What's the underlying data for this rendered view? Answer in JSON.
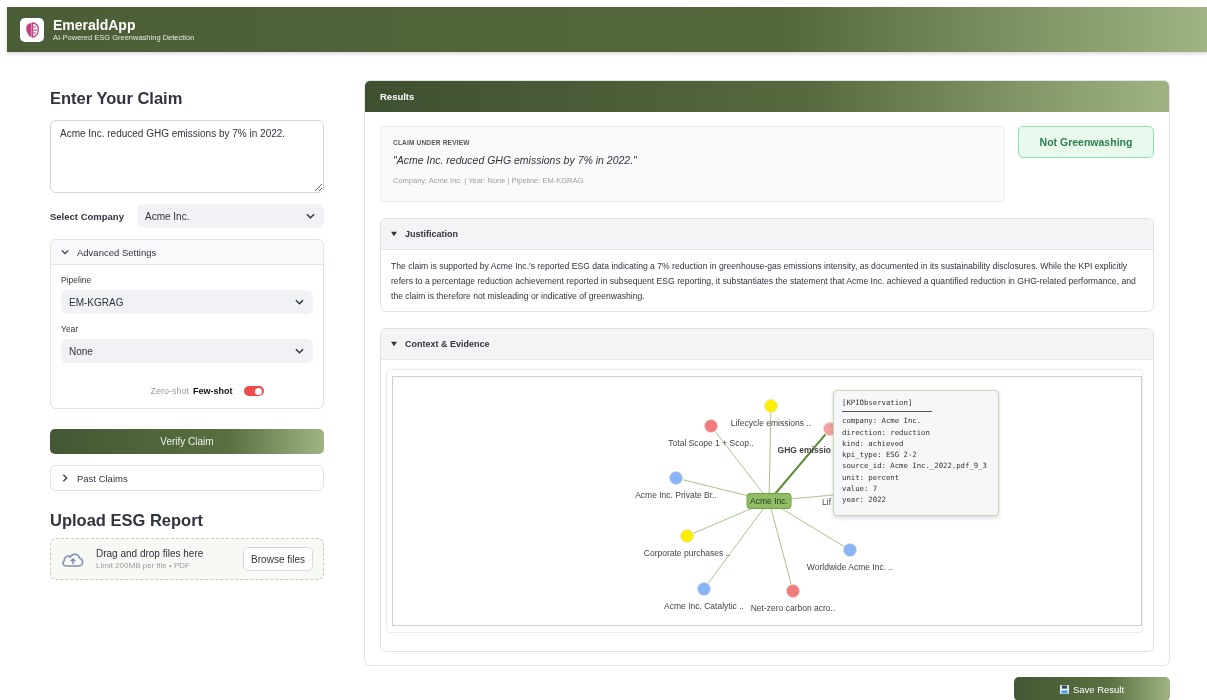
{
  "header": {
    "title": "EmeraldApp",
    "subtitle": "AI-Powered ESG Greenwashing Detection"
  },
  "claim_form": {
    "heading": "Enter Your Claim",
    "claim_value": "Acme Inc. reduced GHG emissions by 7% in 2022.",
    "company": {
      "label": "Select Company",
      "value": "Acme Inc."
    },
    "advanced_settings": {
      "title": "Advanced Settings",
      "expanded": true,
      "pipeline": {
        "label": "Pipeline",
        "value": "EM-KGRAG"
      },
      "year": {
        "label": "Year",
        "value": "None"
      },
      "mode_toggle": {
        "off_label": "Zero-shot",
        "on_label": "Few-shot",
        "on": true
      }
    },
    "verify_button": "Verify Claim",
    "past_claims": {
      "title": "Past Claims",
      "expanded": false
    }
  },
  "upload": {
    "heading": "Upload ESG Report",
    "drop_text": "Drag and drop files here",
    "limit_text": "Limit 200MB per file • PDF",
    "browse_button": "Browse files"
  },
  "results": {
    "title": "Results",
    "claim_label": "CLAIM UNDER REVIEW",
    "claim_quote": "\"Acme Inc. reduced GHG emissions by 7% in 2022.\"",
    "meta": "Company: Acme Inc. | Year: None | Pipeline: EM-KGRAG",
    "verdict": {
      "label": "Not Greenwashing",
      "kind": "not_greenwashing"
    },
    "justification": {
      "title": "Justification",
      "expanded": true,
      "text": "The claim is supported by Acme Inc.'s reported ESG data indicating a 7% reduction in greenhouse-gas emissions intensity, as documented in its sustainability disclosures. While the KPI explicitly refers to a percentage reduction achievement reported in subsequent ESG reporting, it substantiates the statement that Acme Inc. achieved a quantified reduction in GHG-related performance, and the claim is therefore not misleading or indicative of greenwashing."
    },
    "context": {
      "title": "Context & Evidence",
      "expanded": true,
      "graph": {
        "center": "Acme Inc.",
        "nodes": [
          {
            "label": "Lifecycle emissions ..",
            "color": "#ffee00",
            "selected": false
          },
          {
            "label": "Total Scope 1 + Scop..",
            "color": "#f27c7c",
            "selected": false
          },
          {
            "label": "GHG emissio",
            "color": "#f4a0a0",
            "selected": true
          },
          {
            "label": "Acme Inc. Private Br..",
            "color": "#8ab4f8",
            "selected": false
          },
          {
            "label": "Lif",
            "selected": false
          },
          {
            "label": "Corporate purchases ..",
            "color": "#ffee00",
            "selected": false
          },
          {
            "label": "Worldwide Acme Inc. ..",
            "color": "#8ab4f8",
            "selected": false
          },
          {
            "label": "Acme Inc. Catalytic ..",
            "color": "#8ab4f8",
            "selected": false
          },
          {
            "label": "Net-zero carbon acro..",
            "color": "#f27c7c",
            "selected": false
          }
        ],
        "tooltip": {
          "title": "[KPIObservation]",
          "lines": [
            "company: Acme Inc.",
            "direction: reduction",
            "kind: achieved",
            "kpi_type: ESG 2-2",
            "source_id: Acme Inc._2022.pdf_9_3",
            "unit: percent",
            "value: 7",
            "year: 2022"
          ]
        }
      }
    }
  },
  "save_button": "Save Result"
}
